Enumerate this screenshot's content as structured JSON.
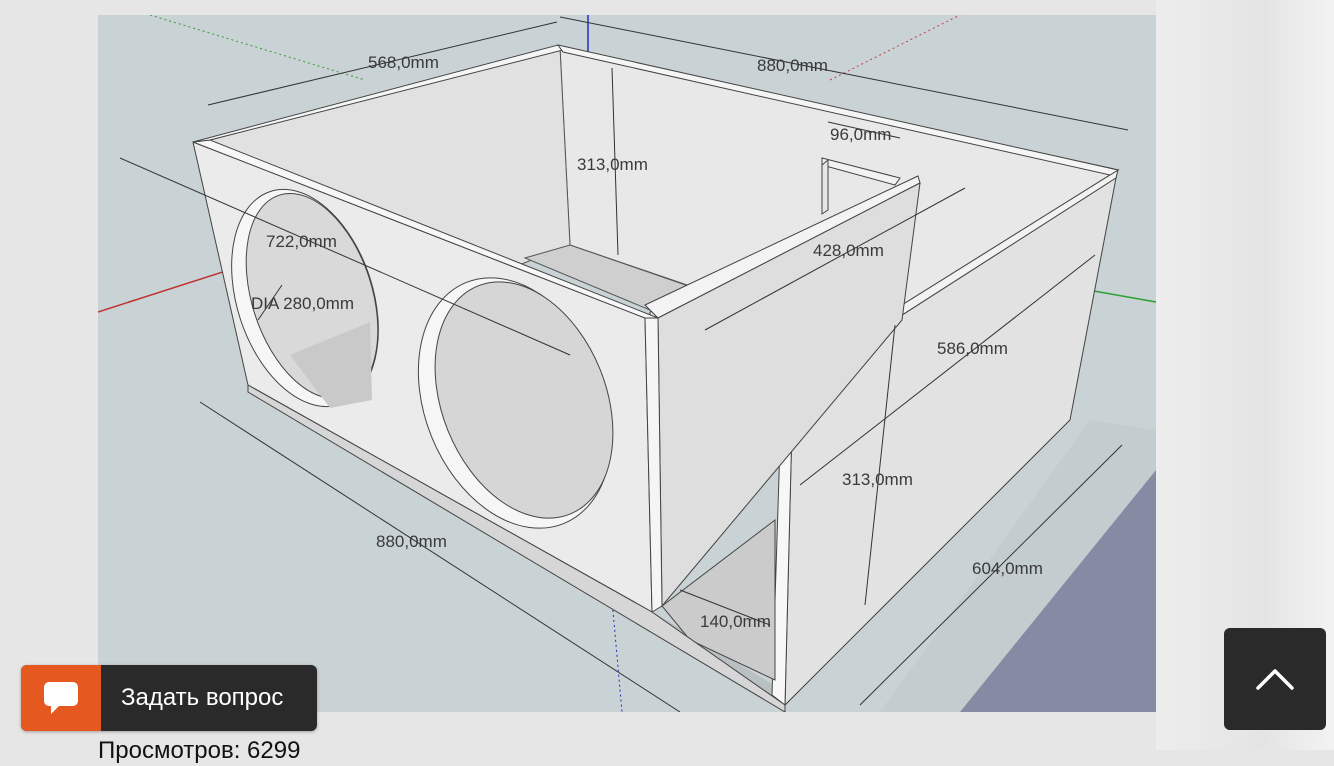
{
  "image": {
    "subject": "subwoofer-box-3d-model",
    "dimensions": [
      {
        "id": "width_top",
        "label": "568,0mm"
      },
      {
        "id": "length_top",
        "label": "880,0mm"
      },
      {
        "id": "port_width",
        "label": "96,0mm"
      },
      {
        "id": "height_inner",
        "label": "313,0mm"
      },
      {
        "id": "diagonal",
        "label": "722,0mm"
      },
      {
        "id": "hole_dia",
        "label": "DIA 280,0mm"
      },
      {
        "id": "port_length",
        "label": "428,0mm"
      },
      {
        "id": "side_depth",
        "label": "586,0mm"
      },
      {
        "id": "height_outer",
        "label": "313,0mm"
      },
      {
        "id": "length_bottom",
        "label": "880,0mm"
      },
      {
        "id": "depth_bottom",
        "label": "604,0mm"
      },
      {
        "id": "port_gap",
        "label": "140,0mm"
      }
    ]
  },
  "actions": {
    "ask_question_label": "Задать вопрос",
    "ask_question_icon": "chat-bubble-icon",
    "scroll_top_icon": "chevron-up-icon"
  },
  "footer": {
    "views_text": "Просмотров: 6299"
  },
  "colors": {
    "ask_accent": "#e5581f",
    "dark_button": "#2a2a2a",
    "model_background": "#c9d2d4"
  }
}
